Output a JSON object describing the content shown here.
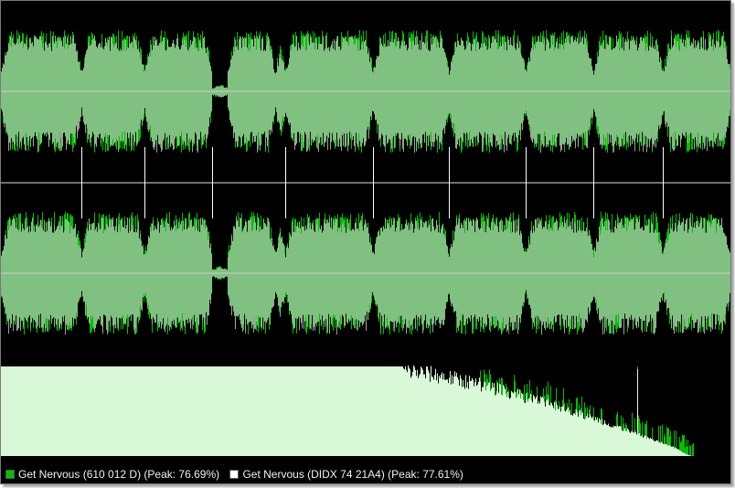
{
  "colors": {
    "background": "#000000",
    "track_a": "#00c000",
    "track_b": "#ffffff",
    "overlap": "#80c080",
    "spectrum": "#d8f8d8",
    "centerline": "#d0d0d0"
  },
  "legend": {
    "track_a": {
      "label": "Get Nervous (610 012 D) (Peak: 76.69%)",
      "swatch_color": "#00c000"
    },
    "track_b": {
      "label": "Get Nervous (DIDX 74 21A4) (Peak: 77.61%)",
      "swatch_color": "#ffffff"
    }
  }
}
